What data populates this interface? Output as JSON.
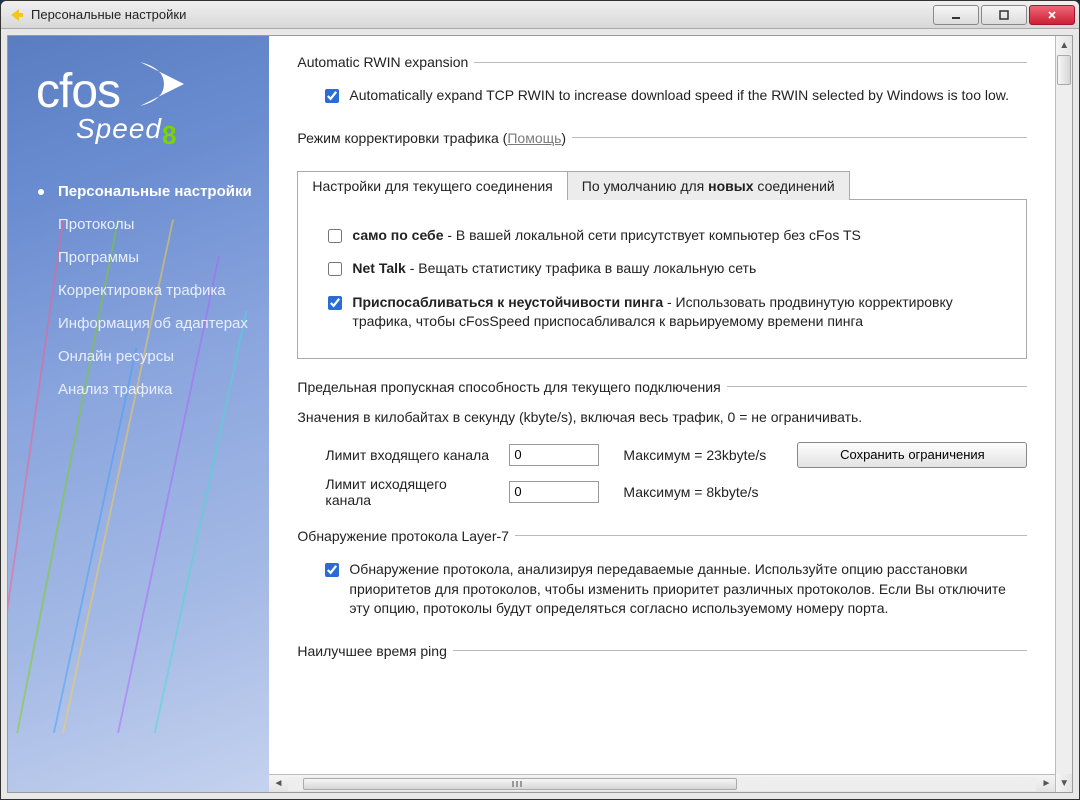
{
  "window": {
    "title": "Персональные настройки"
  },
  "logo": {
    "brand": "cfos",
    "sub": "Speed",
    "ver": "8"
  },
  "sidebar": {
    "items": [
      {
        "label": "Персональные настройки",
        "active": true
      },
      {
        "label": "Протоколы"
      },
      {
        "label": "Программы"
      },
      {
        "label": "Корректировка трафика"
      },
      {
        "label": "Информация об адаптерах"
      },
      {
        "label": "Онлайн ресурсы"
      },
      {
        "label": "Анализ трафика"
      }
    ]
  },
  "sections": {
    "rwin": {
      "legend": "Automatic RWIN expansion",
      "check_label": "Automatically expand TCP RWIN to increase download speed if the RWIN selected by Windows is too low.",
      "checked": true
    },
    "traffic_mode": {
      "legend_pre": "Режим корректировки трафика (",
      "help": "Помощь",
      "legend_post": ")",
      "tabs": {
        "current": "Настройки для текущего соединения",
        "defaults_pre": "По умолчанию для ",
        "defaults_bold": "новых",
        "defaults_post": " соединений"
      },
      "opts": {
        "self_bold": "само по себе",
        "self_rest": " - В вашей локальной сети присутствует компьютер без cFos TS",
        "nettalk_bold": "Net Talk",
        "nettalk_rest": " - Вещать статистику трафика в вашу локальную сеть",
        "ping_bold": "Приспосабливаться к неустойчивости пинга",
        "ping_rest": " - Использовать продвинутую корректировку трафика, чтобы cFosSpeed приспосабливался к варьируемому времени пинга",
        "self_checked": false,
        "nettalk_checked": false,
        "ping_checked": true
      }
    },
    "limits": {
      "legend": "Предельная пропускная способность для текущего подключения",
      "note": "Значения в килобайтах в секунду (kbyte/s), включая весь трафик, 0 = не ограничивать.",
      "in_label": "Лимит входящего канала",
      "out_label": "Лимит исходящего канала",
      "in_value": "0",
      "out_value": "0",
      "in_max": "Максимум = 23kbyte/s",
      "out_max": "Максимум = 8kbyte/s",
      "save": "Сохранить ограничения"
    },
    "layer7": {
      "legend": "Обнаружение протокола Layer-7",
      "check_label": "Обнаружение протокола, анализируя передаваемые данные. Используйте опцию расстановки приоритетов для протоколов, чтобы изменить приоритет различных протоколов. Если Вы отключите эту опцию, протоколы будут определяться согласно используемому номеру порта.",
      "checked": true
    },
    "bestping": {
      "legend": "Наилучшее время ping"
    }
  }
}
